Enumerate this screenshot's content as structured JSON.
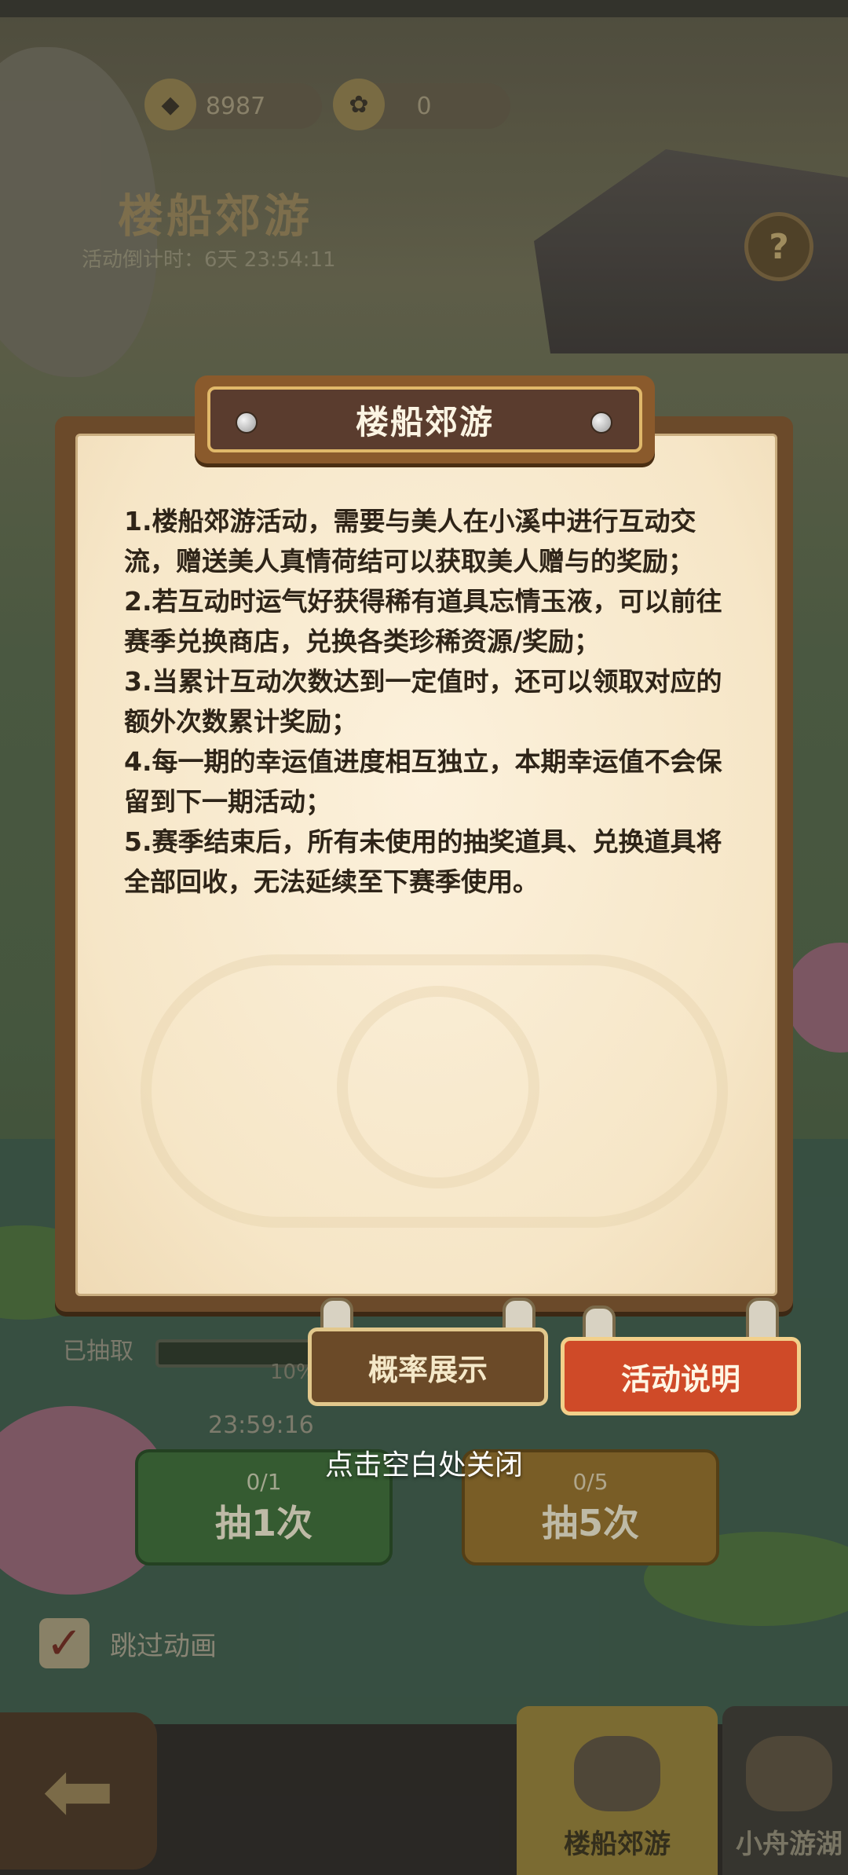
{
  "background": {
    "resources": [
      {
        "icon": "ingot-icon",
        "value": "8987"
      },
      {
        "icon": "lotus-flower-icon",
        "value": "0"
      }
    ],
    "event_title": "楼船郊游",
    "countdown": "活动倒计时：6天 23:54:11",
    "drawn_label": "已抽取",
    "progress_percent": "10%",
    "timer": "23:59:16",
    "draw_buttons": [
      {
        "cost": "0/1",
        "label": "抽1次"
      },
      {
        "cost": "0/5",
        "label": "抽5次"
      }
    ],
    "skip_label": "跳过动画",
    "nav_tabs": [
      {
        "label": "楼船郊游",
        "active": true
      },
      {
        "label": "小舟游湖",
        "active": false
      }
    ]
  },
  "modal": {
    "title": "楼船郊游",
    "rules": [
      "1.楼船郊游活动，需要与美人在小溪中进行互动交流，赠送美人真情荷结可以获取美人赠与的奖励；",
      "2.若互动时运气好获得稀有道具忘情玉液，可以前往赛季兑换商店，兑换各类珍稀资源/奖励；",
      "3.当累计互动次数达到一定值时，还可以领取对应的额外次数累计奖励；",
      "4.每一期的幸运值进度相互独立，本期幸运值不会保留到下一期活动；",
      "5.赛季结束后，所有未使用的抽奖道具、兑换道具将全部回收，无法延续至下赛季使用。"
    ],
    "tabs": {
      "probability": "概率展示",
      "description": "活动说明"
    },
    "close_hint": "点击空白处关闭"
  },
  "colors": {
    "accent_red": "#cf4a28",
    "frame_brown": "#6b4a2a",
    "paper": "#f6e6c7"
  }
}
